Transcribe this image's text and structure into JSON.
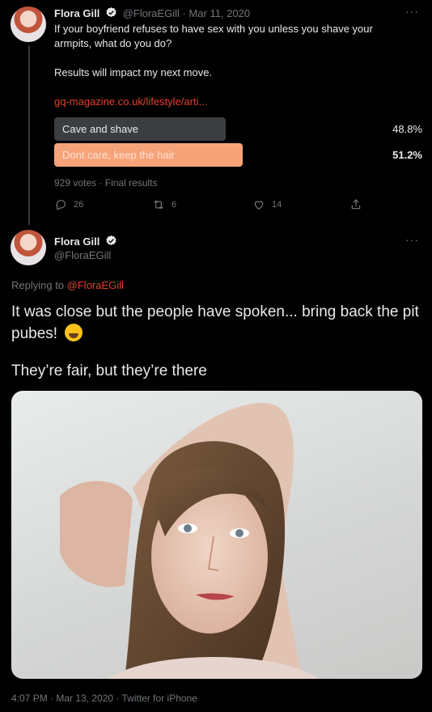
{
  "tweet1": {
    "name": "Flora Gill",
    "handle": "@FloraEGill",
    "date": "Mar 11, 2020",
    "text": "If your boyfriend refuses to have sex with you unless you shave your armpits, what do you do?\n\nResults will impact my next move.",
    "link": "gq-magazine.co.uk/lifestyle/arti...",
    "poll": {
      "options": [
        {
          "label": "Cave and shave",
          "percent": "48.8%",
          "fraction": 0.488,
          "color": "#3b3d40",
          "text_color": "#e7e9ea"
        },
        {
          "label": "Dont care, keep the hair",
          "percent": "51.2%",
          "fraction": 0.512,
          "color": "#f7a37a",
          "text_color": "#fbe2d2"
        }
      ],
      "votes": "929 votes",
      "status": "Final results"
    },
    "actions": {
      "replies": "26",
      "retweets": "6",
      "likes": "14"
    }
  },
  "tweet2": {
    "name": "Flora Gill",
    "handle": "@FloraEGill",
    "replying_label": "Replying to",
    "replying_handle": "@FloraEGill",
    "text": "It was close but the people have spoken... bring back the pit pubes!",
    "emoji": "grinning-squinting-face",
    "subtext": "They’re fair, but they’re there",
    "timestamp": "4:07 PM · Mar 13, 2020 · Twitter for iPhone"
  },
  "colors": {
    "accent": "#e0402b",
    "muted": "#71767b",
    "background": "#000000"
  }
}
